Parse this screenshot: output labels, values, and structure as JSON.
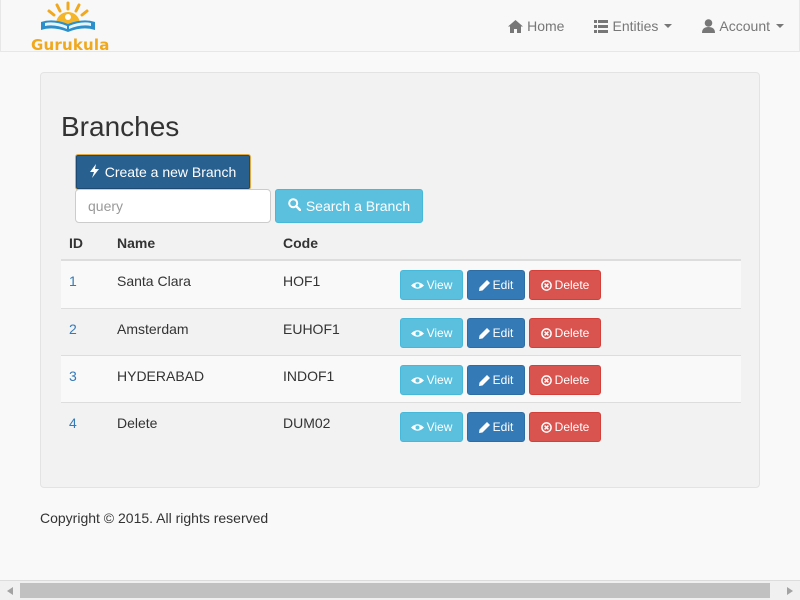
{
  "brand": {
    "name": "Gurukula",
    "color": "#f0a81e"
  },
  "nav": {
    "home": {
      "label": "Home",
      "icon": "home-icon"
    },
    "entities": {
      "label": "Entities",
      "icon": "list-icon"
    },
    "account": {
      "label": "Account",
      "icon": "user-icon"
    }
  },
  "page": {
    "title": "Branches",
    "create_label": "Create a new Branch",
    "search_placeholder": "query",
    "search_value": "",
    "search_label": "Search a Branch"
  },
  "table": {
    "headers": {
      "id": "ID",
      "name": "Name",
      "code": "Code"
    },
    "rows": [
      {
        "id": "1",
        "name": "Santa Clara",
        "code": "HOF1"
      },
      {
        "id": "2",
        "name": "Amsterdam",
        "code": "EUHOF1"
      },
      {
        "id": "3",
        "name": "HYDERABAD",
        "code": "INDOF1"
      },
      {
        "id": "4",
        "name": "Delete",
        "code": "DUM02"
      }
    ],
    "actions": {
      "view": "View",
      "edit": "Edit",
      "delete": "Delete"
    }
  },
  "footer": {
    "text": "Copyright © 2015. All rights reserved"
  },
  "colors": {
    "primary": "#337ab7",
    "info": "#5bc0de",
    "danger": "#d9534f",
    "create_bg": "#286090"
  }
}
